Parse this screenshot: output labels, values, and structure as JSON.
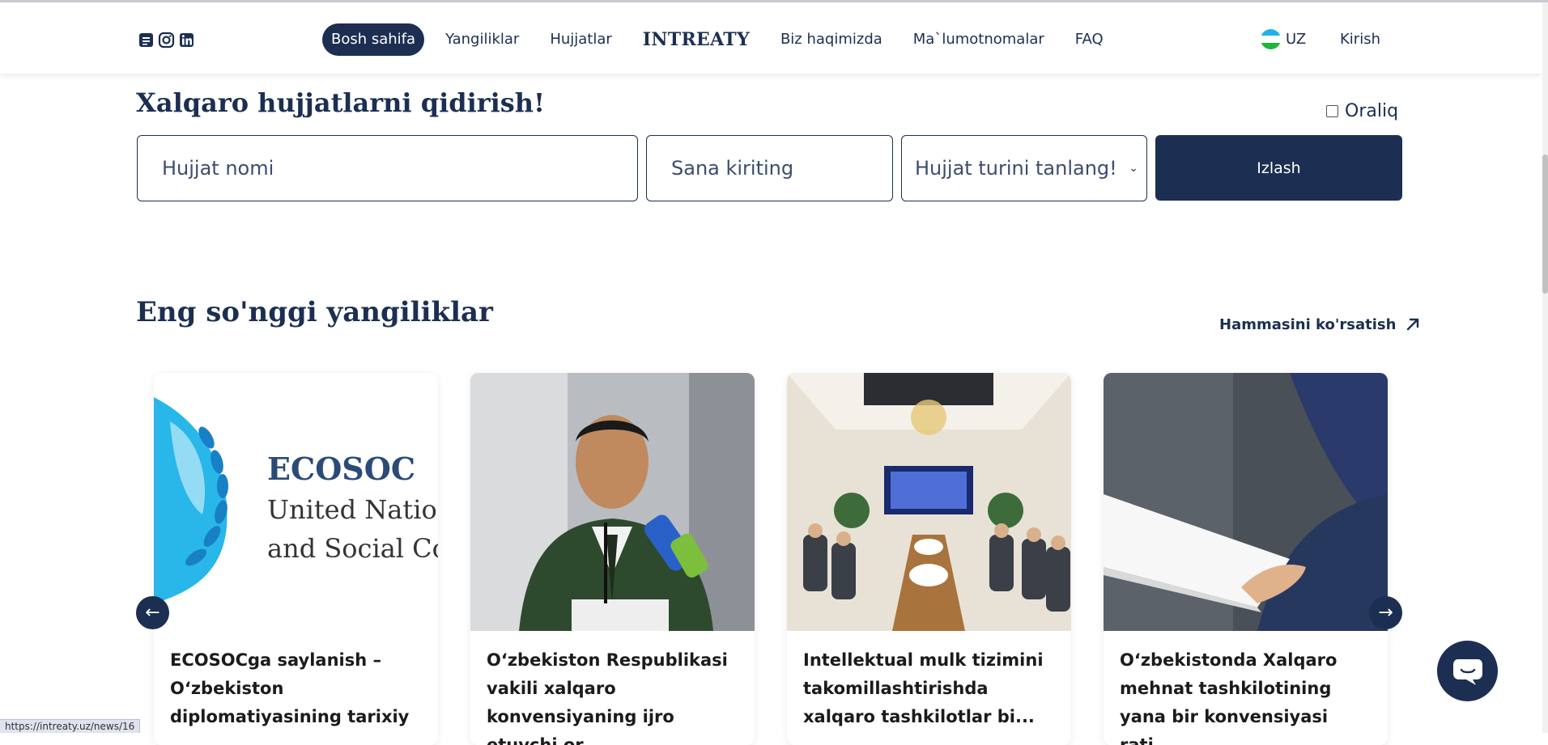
{
  "header": {
    "social_icons": [
      "document-icon",
      "instagram-icon",
      "linkedin-icon"
    ],
    "nav": [
      {
        "label": "Bosh sahifa",
        "active": true
      },
      {
        "label": "Yangiliklar"
      },
      {
        "label": "Hujjatlar"
      },
      {
        "label": "INTREATY",
        "brand": true
      },
      {
        "label": "Biz haqimizda"
      },
      {
        "label": "Ma`lumotnomalar"
      },
      {
        "label": "FAQ"
      }
    ],
    "language": "UZ",
    "login": "Kirish"
  },
  "search": {
    "title": "Xalqaro hujjatlarni qidirish!",
    "range_label": "Oraliq",
    "name_placeholder": "Hujjat nomi",
    "date_placeholder": "Sana kiriting",
    "type_selected": "Hujjat turini tanlang!",
    "button_label": "Izlash"
  },
  "news": {
    "title": "Eng so'nggi yangiliklar",
    "show_all": "Hammasini ko'rsatish",
    "cards": [
      {
        "caption": "ECOSOCga saylanish – O‘zbekiston diplomatiyasining tarixiy",
        "image": "ecosoc-logo"
      },
      {
        "caption": "O‘zbekiston Respublikasi vakili xalqaro konvensiyaning ijro etuvchi or...",
        "image": "official-speaking"
      },
      {
        "caption": "Intellektual mulk tizimini takomillashtirishda xalqaro tashkilotlar bi...",
        "image": "meeting-room"
      },
      {
        "caption": "O‘zbekistonda Xalqaro mehnat tashkilotining yana bir konvensiyasi rati...",
        "image": "document-hands"
      }
    ],
    "image_text": {
      "ecosoc_line1": "ECOSOC",
      "ecosoc_line2": "United Nation",
      "ecosoc_line3": "and Social Cou"
    },
    "prev": "←",
    "next": "→"
  },
  "status_bar": {
    "url": "https://intreaty.uz/news/16"
  },
  "colors": {
    "primary": "#1c2f52",
    "accent_flag_blue": "#1eb2e8",
    "accent_flag_green": "#1eb53a"
  }
}
